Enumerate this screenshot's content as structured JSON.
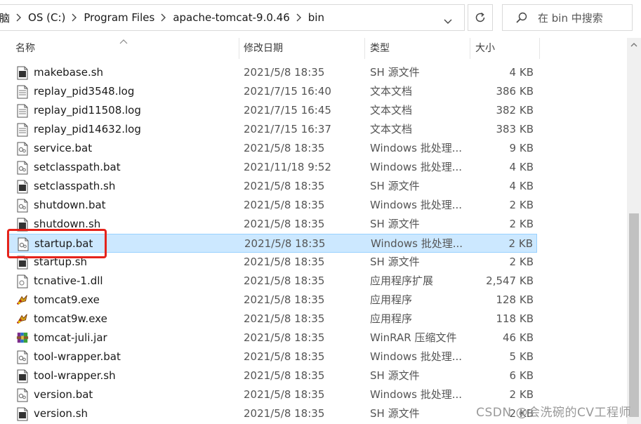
{
  "address": {
    "crumbs": [
      "脑",
      "OS (C:)",
      "Program Files",
      "apache-tomcat-9.0.46",
      "bin"
    ]
  },
  "search": {
    "placeholder": "在 bin 中搜索"
  },
  "columns": {
    "name": "名称",
    "date": "修改日期",
    "type": "类型",
    "size": "大小"
  },
  "files": [
    {
      "name": "makebase.sh",
      "date": "2021/5/8 18:35",
      "type": "SH 源文件",
      "size": "4 KB",
      "icon": "script-file-icon"
    },
    {
      "name": "replay_pid3548.log",
      "date": "2021/7/15 16:40",
      "type": "文本文档",
      "size": "386 KB",
      "icon": "text-file-icon"
    },
    {
      "name": "replay_pid11508.log",
      "date": "2021/7/15 16:45",
      "type": "文本文档",
      "size": "382 KB",
      "icon": "text-file-icon"
    },
    {
      "name": "replay_pid14632.log",
      "date": "2021/7/15 16:37",
      "type": "文本文档",
      "size": "383 KB",
      "icon": "text-file-icon"
    },
    {
      "name": "service.bat",
      "date": "2021/5/8 18:35",
      "type": "Windows 批处理...",
      "size": "9 KB",
      "icon": "batch-file-icon"
    },
    {
      "name": "setclasspath.bat",
      "date": "2021/11/18 9:52",
      "type": "Windows 批处理...",
      "size": "4 KB",
      "icon": "batch-file-icon"
    },
    {
      "name": "setclasspath.sh",
      "date": "2021/5/8 18:35",
      "type": "SH 源文件",
      "size": "4 KB",
      "icon": "script-file-icon"
    },
    {
      "name": "shutdown.bat",
      "date": "2021/5/8 18:35",
      "type": "Windows 批处理...",
      "size": "2 KB",
      "icon": "batch-file-icon"
    },
    {
      "name": "shutdown.sh",
      "date": "2021/5/8 18:35",
      "type": "SH 源文件",
      "size": "2 KB",
      "icon": "script-file-icon"
    },
    {
      "name": "startup.bat",
      "date": "2021/5/8 18:35",
      "type": "Windows 批处理...",
      "size": "2 KB",
      "icon": "batch-file-icon",
      "selected": true
    },
    {
      "name": "startup.sh",
      "date": "2021/5/8 18:35",
      "type": "SH 源文件",
      "size": "2 KB",
      "icon": "script-file-icon"
    },
    {
      "name": "tcnative-1.dll",
      "date": "2021/5/8 18:35",
      "type": "应用程序扩展",
      "size": "2,547 KB",
      "icon": "dll-file-icon"
    },
    {
      "name": "tomcat9.exe",
      "date": "2021/5/8 18:35",
      "type": "应用程序",
      "size": "128 KB",
      "icon": "tomcat-app-icon"
    },
    {
      "name": "tomcat9w.exe",
      "date": "2021/5/8 18:35",
      "type": "应用程序",
      "size": "118 KB",
      "icon": "tomcat-app-icon"
    },
    {
      "name": "tomcat-juli.jar",
      "date": "2021/5/8 18:35",
      "type": "WinRAR 压缩文件",
      "size": "46 KB",
      "icon": "winrar-archive-icon"
    },
    {
      "name": "tool-wrapper.bat",
      "date": "2021/5/8 18:35",
      "type": "Windows 批处理...",
      "size": "5 KB",
      "icon": "batch-file-icon"
    },
    {
      "name": "tool-wrapper.sh",
      "date": "2021/5/8 18:35",
      "type": "SH 源文件",
      "size": "6 KB",
      "icon": "script-file-icon"
    },
    {
      "name": "version.bat",
      "date": "2021/5/8 18:35",
      "type": "Windows 批处理...",
      "size": "2 KB",
      "icon": "batch-file-icon"
    },
    {
      "name": "version.sh",
      "date": "2021/5/8 18:35",
      "type": "SH 源文件",
      "size": "2 KB",
      "icon": "script-file-icon"
    }
  ],
  "colors": {
    "selection": "#cce8ff",
    "selection_border": "#99d1ff",
    "highlight_box": "#e5231b"
  },
  "watermark": "CSDN @会洗碗的CV工程师"
}
